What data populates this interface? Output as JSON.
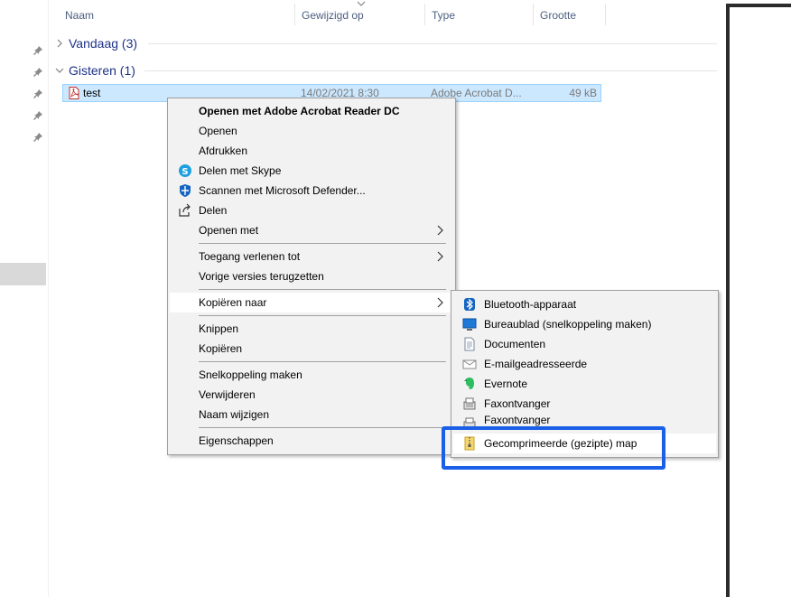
{
  "columns": {
    "name": "Naam",
    "modified": "Gewijzigd op",
    "type": "Type",
    "size": "Grootte"
  },
  "groups": [
    {
      "label": "Vandaag (3)",
      "expanded": false
    },
    {
      "label": "Gisteren (1)",
      "expanded": true
    }
  ],
  "file": {
    "name": "test",
    "modified": "14/02/2021 8:30",
    "type": "Adobe Acrobat D...",
    "size": "49 kB",
    "icon": "pdf-icon"
  },
  "context_menu": {
    "items": [
      {
        "label": "Openen met Adobe Acrobat Reader DC",
        "bold": true
      },
      {
        "label": "Openen"
      },
      {
        "label": "Afdrukken"
      },
      {
        "label": "Delen met Skype",
        "icon": "skype-icon"
      },
      {
        "label": "Scannen met Microsoft Defender...",
        "icon": "defender-icon"
      },
      {
        "label": "Delen",
        "icon": "share-icon"
      },
      {
        "label": "Openen met",
        "submenu": true
      },
      {
        "label": "Toegang verlenen tot",
        "submenu": true
      },
      {
        "label": "Vorige versies terugzetten"
      },
      {
        "label": "Kopiëren naar",
        "submenu": true,
        "active": true
      },
      {
        "label": "Knippen"
      },
      {
        "label": "Kopiëren"
      },
      {
        "label": "Snelkoppeling maken"
      },
      {
        "label": "Verwijderen"
      },
      {
        "label": "Naam wijzigen"
      },
      {
        "label": "Eigenschappen"
      }
    ]
  },
  "send_to_menu": {
    "items": [
      {
        "label": "Bluetooth-apparaat",
        "icon": "bluetooth-icon"
      },
      {
        "label": "Bureaublad (snelkoppeling maken)",
        "icon": "desktop-icon"
      },
      {
        "label": "Documenten",
        "icon": "documents-icon"
      },
      {
        "label": "E-mailgeadresseerde",
        "icon": "mail-icon"
      },
      {
        "label": "Evernote",
        "icon": "evernote-icon"
      },
      {
        "label": "Faxontvanger",
        "icon": "fax-icon"
      },
      {
        "label": "Faxontvanger",
        "icon": "fax-icon"
      },
      {
        "label": "Gecomprimeerde (gezipte) map",
        "icon": "zip-folder-icon",
        "highlighted": true
      }
    ]
  },
  "colors": {
    "selection": "#cce8ff",
    "group_text": "#1e3287",
    "highlight_border": "#1a5fe8"
  }
}
